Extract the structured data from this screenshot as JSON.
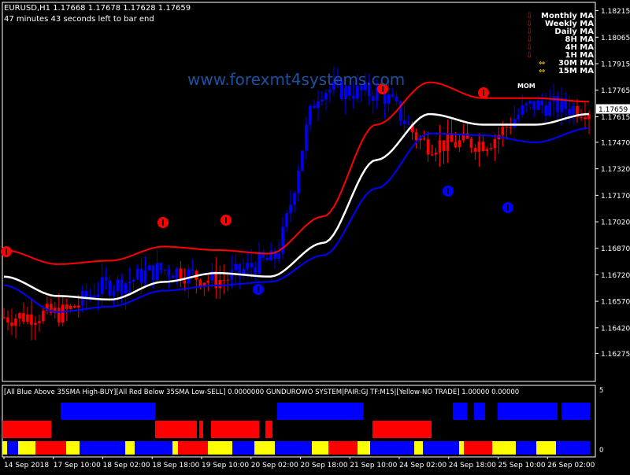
{
  "header": {
    "symbol_line": "EURUSD,H1  1.17668 1.17678 1.17628 1.17659",
    "timer_text": "47 minutes 43 seconds left to bar end"
  },
  "watermark": "www.forexmt4systems.com",
  "ma_panel": {
    "labels": [
      "Monthly MA",
      "Weekly MA",
      "Daily MA",
      "8H MA",
      "4H MA",
      "1H MA",
      "30M MA",
      "15M MA"
    ],
    "signals": [
      "down",
      "down",
      "down",
      "down",
      "down",
      "down",
      "both",
      "both"
    ],
    "mom_label": "MOM"
  },
  "colors": {
    "bull": "#0000ff",
    "bear": "#ff0000",
    "neutral": "#ffff00",
    "midline": "#ffffff",
    "background": "#000000"
  },
  "price_axis": {
    "ticks": [
      "1.18215",
      "1.18065",
      "1.17915",
      "1.17765",
      "1.17615",
      "1.17470",
      "1.17320",
      "1.17170",
      "1.17020",
      "1.16870",
      "1.16720",
      "1.16570",
      "1.16420",
      "1.16275"
    ],
    "current_price": "1.17659"
  },
  "indicator_panel": {
    "header_text": "[All Blue Above 35SMA High-BUY][All Red Below 35SMA Low-SELL] 0.0000000  GUNDUROWO SYSTEM|PAIR:GJ TF:M15|[Yellow-NO TRADE] 1.00000 0.00000",
    "scale_top": "5",
    "scale_bottom": "0"
  },
  "time_axis": [
    "14 Sep 2018",
    "17 Sep 10:00",
    "18 Sep 02:00",
    "18 Sep 18:00",
    "19 Sep 10:00",
    "20 Sep 02:00",
    "20 Sep 18:00",
    "21 Sep 10:00",
    "24 Sep 02:00",
    "24 Sep 18:00",
    "25 Sep 10:00",
    "26 Sep 02:00"
  ],
  "chart_data": {
    "type": "line",
    "title": "",
    "xlabel": "",
    "ylabel": "",
    "x": [
      "14 Sep 2018",
      "17 Sep 10:00",
      "18 Sep 02:00",
      "18 Sep 18:00",
      "19 Sep 10:00",
      "20 Sep 02:00",
      "20 Sep 18:00",
      "21 Sep 10:00",
      "24 Sep 02:00",
      "24 Sep 18:00",
      "25 Sep 10:00",
      "26 Sep 02:00"
    ],
    "ylim": [
      1.1625,
      1.1824
    ],
    "series": [
      {
        "name": "",
        "role": "midline",
        "values": [
          1.1671,
          1.166,
          1.1658,
          1.1668,
          1.1673,
          1.1671,
          1.169,
          1.1737,
          1.1763,
          1.1757,
          1.1757,
          1.1763
        ]
      },
      {
        "name": "",
        "role": "upper-band",
        "values": [
          1.1686,
          1.1678,
          1.168,
          1.1688,
          1.1686,
          1.1684,
          1.1705,
          1.1757,
          1.1781,
          1.1772,
          1.1772,
          1.177
        ]
      },
      {
        "name": "",
        "role": "lower-band",
        "values": [
          1.1666,
          1.1651,
          1.1654,
          1.1663,
          1.1666,
          1.1668,
          1.1683,
          1.1721,
          1.1752,
          1.1751,
          1.1747,
          1.1755
        ]
      },
      {
        "name": "",
        "role": "price",
        "values": [
          1.1648,
          1.165,
          1.1666,
          1.1675,
          1.1669,
          1.168,
          1.1777,
          1.1775,
          1.1746,
          1.1747,
          1.1768,
          1.1766
        ]
      }
    ],
    "trend_rows": {
      "categories": [
        "up",
        "down",
        "neutral"
      ],
      "segments_note": "three colour bars at bottom of indicator window"
    }
  }
}
